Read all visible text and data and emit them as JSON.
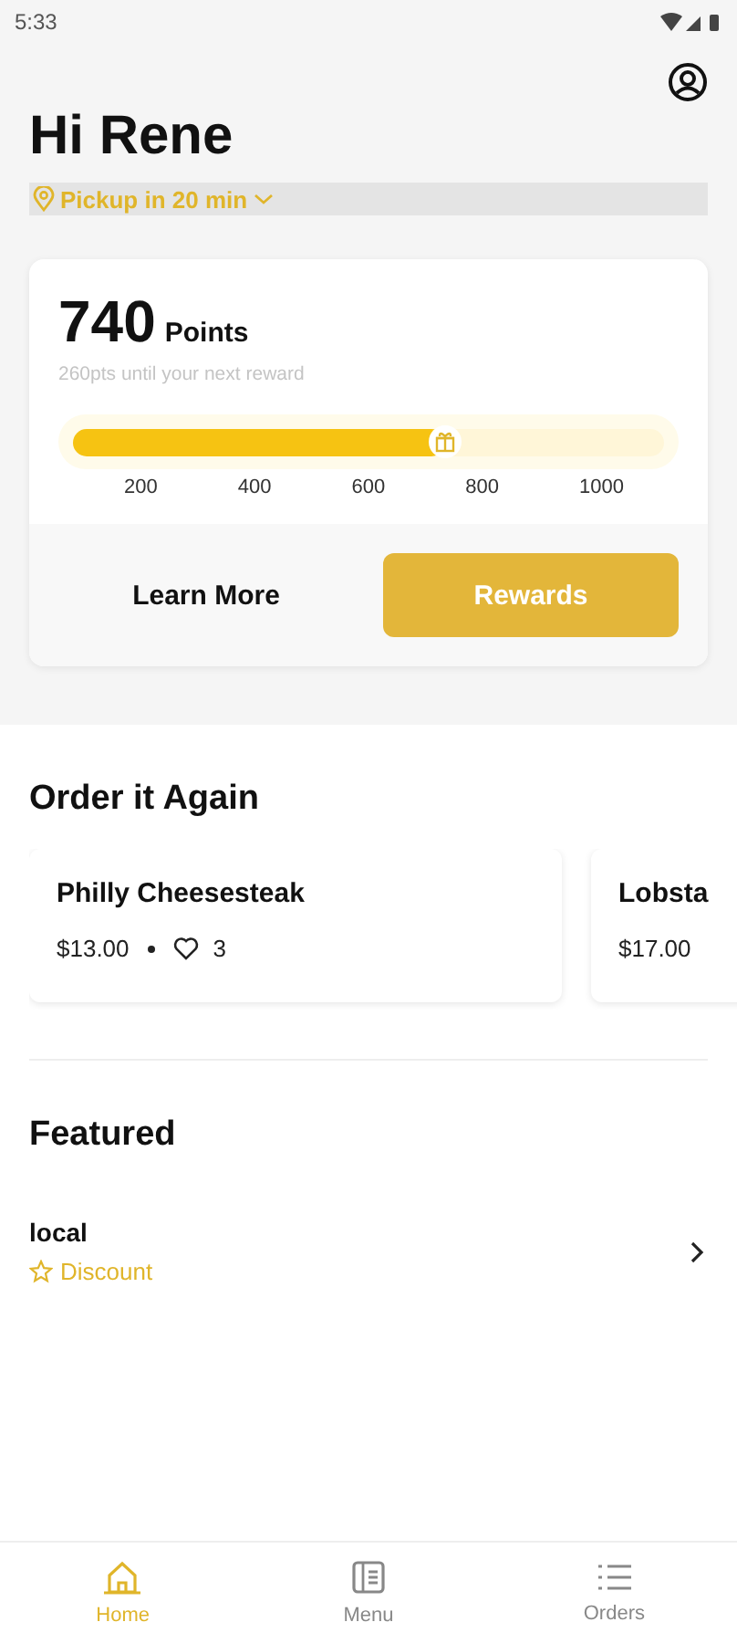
{
  "status_bar": {
    "time": "5:33"
  },
  "greeting": "Hi Rene",
  "pickup": {
    "label": "Pickup in 20 min"
  },
  "rewards": {
    "points": "740",
    "points_label": "Points",
    "subtitle": "260pts until your next reward",
    "level": 0.63,
    "ticks": [
      "200",
      "400",
      "600",
      "800",
      "1000"
    ],
    "buttons": [
      {
        "label": "Learn More",
        "kind": "text"
      },
      {
        "label": "Rewards",
        "kind": "filled"
      }
    ]
  },
  "order_again": {
    "title": "Order it Again",
    "items": [
      {
        "name": "Philly Cheesesteak",
        "price": "$13.00",
        "likes": "3"
      },
      {
        "name": "Lobsta",
        "price": "$17.00"
      }
    ]
  },
  "featured": {
    "title": "Featured",
    "items": [
      {
        "name": "local",
        "tag": "Discount"
      }
    ]
  },
  "tabs": [
    {
      "label": "Home",
      "kind": "home",
      "selected": true
    },
    {
      "label": "Menu",
      "kind": "menu",
      "selected": false
    },
    {
      "label": "Orders",
      "kind": "orders",
      "selected": false
    }
  ]
}
